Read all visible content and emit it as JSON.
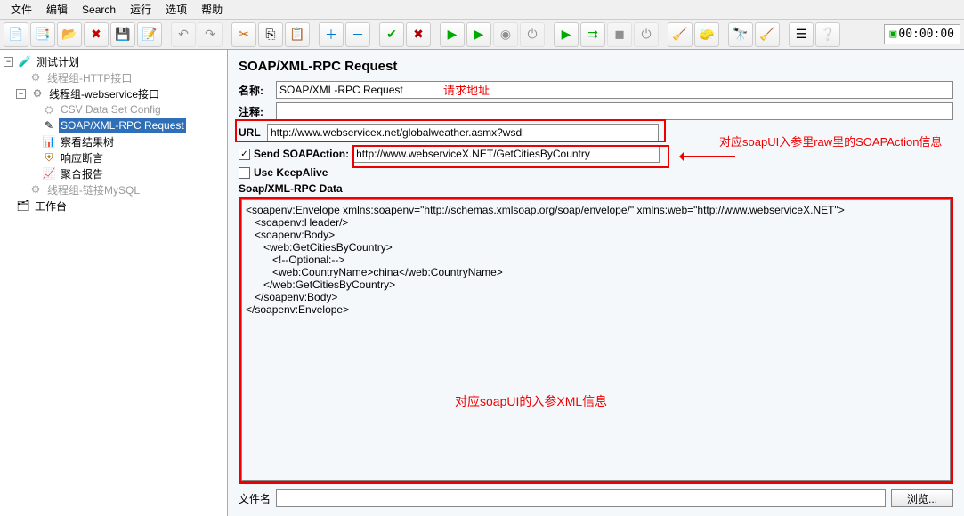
{
  "menu": {
    "items": [
      "文件",
      "编辑",
      "Search",
      "运行",
      "选项",
      "帮助"
    ]
  },
  "toolbar": {
    "buttons": [
      {
        "name": "new-icon",
        "glyph": "📄"
      },
      {
        "name": "templates-icon",
        "glyph": "📑"
      },
      {
        "name": "open-icon",
        "glyph": "📂"
      },
      {
        "name": "close-icon",
        "glyph": "✖"
      },
      {
        "name": "save-icon",
        "glyph": "💾"
      },
      {
        "name": "save-as-icon",
        "glyph": "📝"
      }
    ],
    "edit_group": [
      {
        "name": "undo-icon",
        "glyph": "↶",
        "disabled": true
      },
      {
        "name": "redo-icon",
        "glyph": "↷",
        "disabled": true
      }
    ],
    "clip_group": [
      {
        "name": "cut-icon",
        "glyph": "✂"
      },
      {
        "name": "copy-icon",
        "glyph": "⎘"
      },
      {
        "name": "paste-icon",
        "glyph": "📋"
      }
    ],
    "tree_group": [
      {
        "name": "expand-icon",
        "glyph": "＋"
      },
      {
        "name": "collapse-icon",
        "glyph": "－"
      }
    ],
    "toggle_group": [
      {
        "name": "enable-icon",
        "glyph": "✔"
      },
      {
        "name": "disable-icon",
        "glyph": "✖"
      }
    ],
    "run_group": [
      {
        "name": "start-icon",
        "glyph": "▶"
      },
      {
        "name": "start-no-pause-icon",
        "glyph": "▶"
      },
      {
        "name": "stop-icon",
        "glyph": "◉",
        "disabled": true
      },
      {
        "name": "shutdown-icon",
        "glyph": "⏻",
        "disabled": true
      }
    ],
    "remote_group": [
      {
        "name": "remote-start-icon",
        "glyph": "▶"
      },
      {
        "name": "remote-start-all-icon",
        "glyph": "⇉"
      },
      {
        "name": "remote-stop-icon",
        "glyph": "◼",
        "disabled": true
      },
      {
        "name": "remote-exit-icon",
        "glyph": "⏻",
        "disabled": true
      }
    ],
    "clear_group": [
      {
        "name": "clear-icon",
        "glyph": "🧹"
      },
      {
        "name": "clear-all-icon",
        "glyph": "🧽"
      }
    ],
    "search_group": [
      {
        "name": "search-icon",
        "glyph": "🔭"
      },
      {
        "name": "reset-search-icon",
        "glyph": "🧹"
      }
    ],
    "misc_group": [
      {
        "name": "function-helper-icon",
        "glyph": "☰"
      },
      {
        "name": "help-icon",
        "glyph": "❔"
      }
    ],
    "timer": "00:00:00"
  },
  "tree": {
    "root": {
      "label": "测试计划"
    },
    "group1": {
      "label": "线程组-HTTP接口",
      "disabled": true
    },
    "group2": {
      "label": "线程组-webservice接口"
    },
    "csv": {
      "label": "CSV Data Set Config",
      "disabled": true
    },
    "soap": {
      "label": "SOAP/XML-RPC Request",
      "selected": true
    },
    "result_tree": {
      "label": "察看结果树"
    },
    "assertion": {
      "label": "响应断言"
    },
    "aggregate": {
      "label": "聚合报告"
    },
    "group3": {
      "label": "线程组-链接MySQL",
      "disabled": true
    },
    "workbench": {
      "label": "工作台"
    }
  },
  "form": {
    "title": "SOAP/XML-RPC Request",
    "name_label": "名称:",
    "name_value": "SOAP/XML-RPC Request",
    "comment_label": "注释:",
    "url_label": "URL",
    "url_value": "http://www.webservicex.net/globalweather.asmx?wsdl",
    "send_soapaction_label": "Send SOAPAction:",
    "send_soapaction_checked": true,
    "soapaction_value": "http://www.webserviceX.NET/GetCitiesByCountry",
    "use_keepalive_label": "Use KeepAlive",
    "use_keepalive_checked": false,
    "data_label": "Soap/XML-RPC Data",
    "data_body": "<soapenv:Envelope xmlns:soapenv=\"http://schemas.xmlsoap.org/soap/envelope/\" xmlns:web=\"http://www.webserviceX.NET\">\n   <soapenv:Header/>\n   <soapenv:Body>\n      <web:GetCitiesByCountry>\n         <!--Optional:-->\n         <web:CountryName>china</web:CountryName>\n      </web:GetCitiesByCountry>\n   </soapenv:Body>\n</soapenv:Envelope>",
    "file_label": "文件名",
    "browse_label": "浏览..."
  },
  "annotations": {
    "url": "请求地址",
    "soapaction": "对应soapUI入参里raw里的SOAPAction信息",
    "body": "对应soapUI的入参XML信息"
  }
}
